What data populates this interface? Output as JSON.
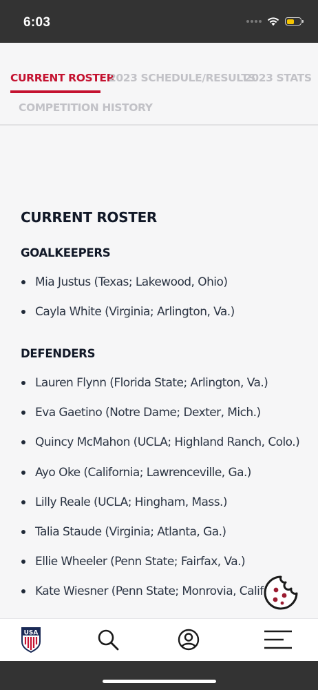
{
  "status_bar": {
    "time": "6:03",
    "battery_level": 0.55,
    "battery_color": "#f5c400"
  },
  "tabs": [
    {
      "label": "CURRENT ROSTER",
      "active": true
    },
    {
      "label": "2023 SCHEDULE/RESULTS",
      "active": false
    },
    {
      "label": "2023 STATS",
      "active": false
    },
    {
      "label": "COMPETITION HISTORY",
      "active": false
    }
  ],
  "accent_color": "#c41230",
  "roster": {
    "title": "CURRENT ROSTER",
    "sections": [
      {
        "heading": "GOALKEEPERS",
        "players": [
          "Mia Justus (Texas; Lakewood, Ohio)",
          "Cayla White (Virginia; Arlington, Va.)"
        ]
      },
      {
        "heading": "DEFENDERS",
        "players": [
          "Lauren Flynn (Florida State; Arlington, Va.)",
          "Eva Gaetino (Notre Dame; Dexter, Mich.)",
          "Quincy McMahon (UCLA; Highland Ranch, Colo.)",
          "Ayo Oke (California; Lawrenceville, Ga.)",
          "Lilly Reale (UCLA; Hingham, Mass.)",
          "Talia Staude (Virginia; Atlanta, Ga.)",
          "Ellie Wheeler (Penn State; Fairfax, Va.)",
          "Kate Wiesner (Penn State; Monrovia, Calif"
        ]
      }
    ]
  },
  "icons": {
    "cookie": "cookie-icon",
    "home": "ussoccer-crest-icon",
    "search": "search-icon",
    "account": "user-icon",
    "menu": "menu-icon"
  },
  "crest_text": "USA"
}
